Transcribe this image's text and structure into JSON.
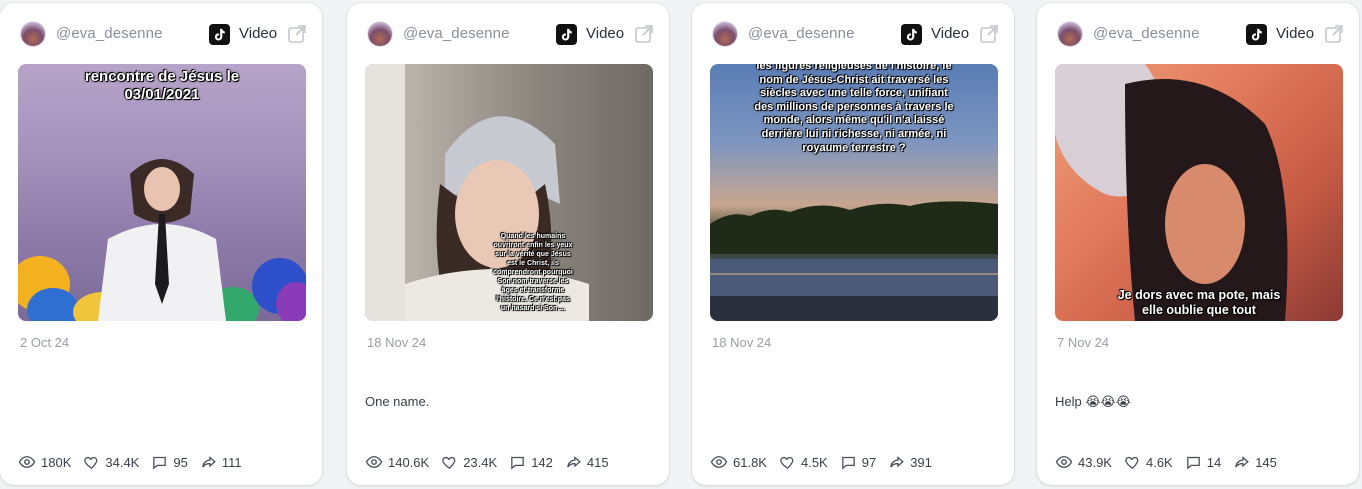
{
  "cards": [
    {
      "handle": "@eva_desenne",
      "type_label": "Video",
      "thumb_overlay": "rencontre de Jésus le 03/01/2021",
      "date": "2 Oct 24",
      "caption": "",
      "views": "180K",
      "likes": "34.4K",
      "comments": "95",
      "shares": "111"
    },
    {
      "handle": "@eva_desenne",
      "type_label": "Video",
      "thumb_overlay": "Quand les humains ouvriront enfin les yeux sur la vérité que Jésus est le Christ, ils comprendront pourquoi Son nom traverse les âges et transforme l'histoire. Ce n'est pas un hasard si Son ...",
      "date": "18 Nov 24",
      "caption": "One name.",
      "views": "140.6K",
      "likes": "23.4K",
      "comments": "142",
      "shares": "415"
    },
    {
      "handle": "@eva_desenne",
      "type_label": "Video",
      "thumb_overlay": "les figures religieuses de l'histoire, le nom de Jésus-Christ ait traversé les siècles avec une telle force, unifiant des millions de personnes à travers le monde, alors même qu'il n'a laissé derrière lui ni richesse, ni armée, ni royaume terrestre ?",
      "date": "18 Nov 24",
      "caption": "",
      "views": "61.8K",
      "likes": "4.5K",
      "comments": "97",
      "shares": "391"
    },
    {
      "handle": "@eva_desenne",
      "type_label": "Video",
      "thumb_overlay": "Je dors avec ma pote, mais elle oublie que tout",
      "date": "7 Nov 24",
      "caption": "Help 😭😭😭",
      "views": "43.9K",
      "likes": "4.6K",
      "comments": "14",
      "shares": "145"
    }
  ],
  "colors": {
    "background": "#f2f3f5",
    "card": "#ffffff",
    "muted_text": "#9a9da6",
    "handle_text": "#8c8f9a"
  },
  "icons": [
    "tiktok-icon",
    "external-link-icon",
    "eye-icon",
    "heart-icon",
    "comment-icon",
    "share-icon"
  ]
}
